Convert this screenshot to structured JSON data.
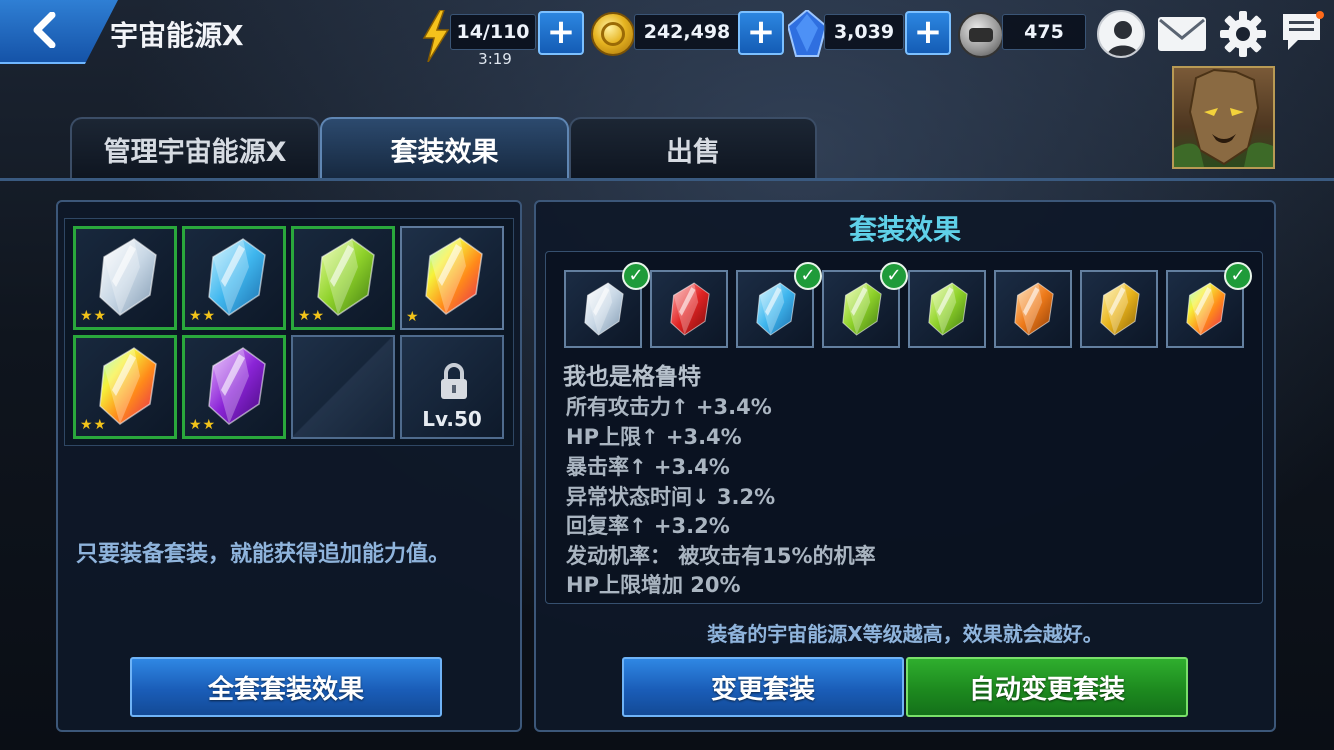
{
  "header": {
    "title": "宇宙能源X",
    "energy": "14/110",
    "energy_timer": "3:19",
    "gold": "242,498",
    "crystals": "3,039",
    "tokens": "475"
  },
  "tabs": [
    {
      "label": "管理宇宙能源X"
    },
    {
      "label": "套装效果"
    },
    {
      "label": "出售"
    }
  ],
  "left_panel": {
    "slots": [
      {
        "gem": "white",
        "stars": "★★"
      },
      {
        "gem": "blue",
        "stars": "★★"
      },
      {
        "gem": "green",
        "stars": "★★"
      },
      {
        "gem": "rainbow",
        "stars": "★"
      },
      {
        "gem": "rainbow",
        "stars": "★★"
      },
      {
        "gem": "purple",
        "stars": "★★"
      },
      {
        "gem": "empty",
        "stars": ""
      },
      {
        "gem": "locked",
        "stars": ""
      }
    ],
    "lock_level": "Lv.50",
    "description": "只要装备套装，就能获得追加能力值。",
    "full_set_button": "全套套装效果"
  },
  "right_panel": {
    "title": "套装效果",
    "set_gems": [
      {
        "gem": "white",
        "checked": true
      },
      {
        "gem": "red",
        "checked": false
      },
      {
        "gem": "blue",
        "checked": true
      },
      {
        "gem": "green",
        "checked": true
      },
      {
        "gem": "green",
        "checked": false
      },
      {
        "gem": "orange",
        "checked": false
      },
      {
        "gem": "yellow",
        "checked": false
      },
      {
        "gem": "rainbow",
        "checked": true
      }
    ],
    "set_name": "我也是格鲁特",
    "effects": [
      "所有攻击力↑ +3.4%",
      "HP上限↑ +3.4%",
      "暴击率↑ +3.4%",
      "异常状态时间↓ 3.2%",
      "回复率↑ +3.2%",
      "发动机率： 被攻击有15%的机率",
      "HP上限增加 20%"
    ],
    "note": "装备的宇宙能源X等级越高，效果就会越好。",
    "change_button": "变更套装",
    "auto_change_button": "自动变更套装"
  },
  "colors": {
    "accent_blue": "#1a5db8",
    "accent_green": "#1d8a1f",
    "title_cyan": "#5fd0e8",
    "check_green": "#1f9b3a"
  }
}
